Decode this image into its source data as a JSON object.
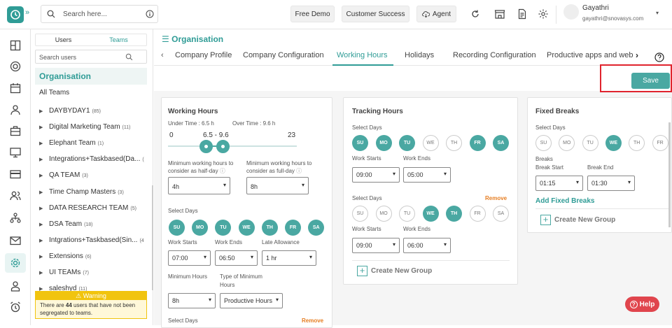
{
  "header": {
    "search_placeholder": "Search here...",
    "free_demo": "Free Demo",
    "customer_success": "Customer Success",
    "agent": "Agent",
    "user_name": "Gayathri",
    "user_email": "gayathri@snovasys.com"
  },
  "sidebar_icons": [
    "dashboard-icon",
    "activity-icon",
    "calendar-icon",
    "user-icon",
    "briefcase-icon",
    "monitor-icon",
    "card-icon",
    "users-icon",
    "org-chart-icon",
    "mail-icon",
    "settings-icon",
    "person-badge-icon",
    "clock-icon"
  ],
  "teams_panel": {
    "tab_users": "Users",
    "tab_teams": "Teams",
    "search_placeholder": "Search users",
    "org_label": "Organisation",
    "all_teams": "All Teams",
    "teams": [
      {
        "name": "DAYBYDAY1",
        "count": "(85)"
      },
      {
        "name": "Digital Marketing Team",
        "count": "(11)"
      },
      {
        "name": "Elephant Team",
        "count": "(1)"
      },
      {
        "name": "Integrations+Taskbased(Da...",
        "count": "("
      },
      {
        "name": "QA TEAM",
        "count": "(3)"
      },
      {
        "name": "Time Champ Masters",
        "count": "(3)"
      },
      {
        "name": "DATA RESEARCH TEAM",
        "count": "(5)"
      },
      {
        "name": "DSA Team",
        "count": "(18)"
      },
      {
        "name": "Intgrations+Taskbased(Sin...",
        "count": "(4"
      },
      {
        "name": "Extensions",
        "count": "(6)"
      },
      {
        "name": "UI TEAMs",
        "count": "(7)"
      },
      {
        "name": "saleshyd",
        "count": "(11)"
      }
    ],
    "warning_title": "Warning",
    "warning_pre": "There are ",
    "warning_count": "44",
    "warning_post": " users that have not been segregated to teams."
  },
  "main": {
    "title": "Organisation",
    "tabs": [
      "Company Profile",
      "Company Configuration",
      "Working Hours",
      "Holidays",
      "Recording Configuration",
      "Productive apps and web"
    ],
    "active_tab": "Working Hours",
    "save": "Save"
  },
  "working_hours": {
    "title": "Working Hours",
    "under_time": "Under Time : 6.5 h",
    "over_time": "Over Time : 9.6 h",
    "slider_min": "0",
    "slider_range": "6.5 - 9.6",
    "slider_max": "23",
    "slider_low_value": 6.5,
    "slider_high_value": 9.6,
    "slider_scale_max": 23,
    "min_half_label": "Minimum working hours to consider as half-day",
    "min_full_label": "Minimum working hours to consider as full-day",
    "half_value": "4h",
    "full_value": "8h",
    "select_days": "Select Days",
    "days": [
      {
        "label": "SU",
        "on": true
      },
      {
        "label": "MO",
        "on": true
      },
      {
        "label": "TU",
        "on": true
      },
      {
        "label": "WE",
        "on": true
      },
      {
        "label": "TH",
        "on": true
      },
      {
        "label": "FR",
        "on": true
      },
      {
        "label": "SA",
        "on": true
      }
    ],
    "work_starts": "Work Starts",
    "work_ends": "Work Ends",
    "late_allowance": "Late Allowance",
    "start_value": "07:00",
    "end_value": "06:50",
    "late_value": "1 hr",
    "minimum_hours": "Minimum Hours",
    "type_min_hours": "Type of Minimum Hours",
    "min_hours_value": "8h",
    "type_value": "Productive Hours",
    "select_days_2": "Select Days",
    "remove": "Remove"
  },
  "tracking_hours": {
    "title": "Tracking Hours",
    "select_days": "Select Days",
    "group1_days": [
      {
        "label": "SU",
        "on": true
      },
      {
        "label": "MO",
        "on": true
      },
      {
        "label": "TU",
        "on": true
      },
      {
        "label": "WE",
        "on": false
      },
      {
        "label": "TH",
        "on": false
      },
      {
        "label": "FR",
        "on": true
      },
      {
        "label": "SA",
        "on": true
      }
    ],
    "work_starts": "Work Starts",
    "work_ends": "Work Ends",
    "g1_start": "09:00",
    "g1_end": "05:00",
    "select_days_2": "Select Days",
    "remove": "Remove",
    "group2_days": [
      {
        "label": "SU",
        "on": false
      },
      {
        "label": "MO",
        "on": false
      },
      {
        "label": "TU",
        "on": false
      },
      {
        "label": "WE",
        "on": true
      },
      {
        "label": "TH",
        "on": true
      },
      {
        "label": "FR",
        "on": false
      },
      {
        "label": "SA",
        "on": false
      }
    ],
    "g2_start": "09:00",
    "g2_end": "06:00",
    "create_group": "Create New Group"
  },
  "fixed_breaks": {
    "title": "Fixed Breaks",
    "select_days": "Select Days",
    "days": [
      {
        "label": "SU",
        "on": false
      },
      {
        "label": "MO",
        "on": false
      },
      {
        "label": "TU",
        "on": false
      },
      {
        "label": "WE",
        "on": true
      },
      {
        "label": "TH",
        "on": false
      },
      {
        "label": "FR",
        "on": false
      }
    ],
    "breaks": "Breaks",
    "break_start": "Break Start",
    "break_end": "Break End",
    "start_value": "01:15",
    "end_value": "01:30",
    "add_fixed_breaks": "Add Fixed Breaks",
    "create_group": "Create New Group"
  },
  "help": "Help"
}
